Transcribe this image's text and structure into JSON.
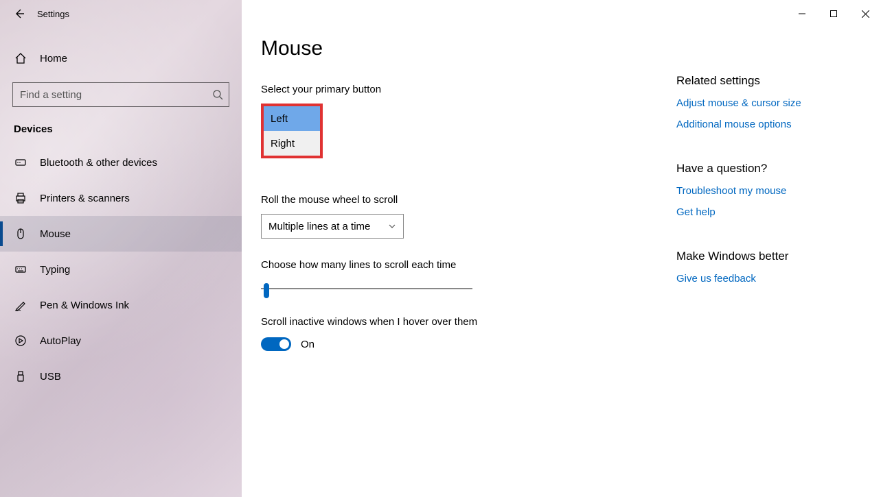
{
  "app_title": "Settings",
  "window_controls": {
    "minimize": "–",
    "maximize": "□",
    "close": "×"
  },
  "sidebar": {
    "home": "Home",
    "search_placeholder": "Find a setting",
    "category": "Devices",
    "items": [
      {
        "id": "bluetooth",
        "label": "Bluetooth & other devices"
      },
      {
        "id": "printers",
        "label": "Printers & scanners"
      },
      {
        "id": "mouse",
        "label": "Mouse",
        "selected": true
      },
      {
        "id": "typing",
        "label": "Typing"
      },
      {
        "id": "pen",
        "label": "Pen & Windows Ink"
      },
      {
        "id": "autoplay",
        "label": "AutoPlay"
      },
      {
        "id": "usb",
        "label": "USB"
      }
    ]
  },
  "page": {
    "title": "Mouse",
    "primary_button": {
      "label": "Select your primary button",
      "options": [
        "Left",
        "Right"
      ],
      "selected": "Left"
    },
    "roll_wheel": {
      "label": "Roll the mouse wheel to scroll",
      "value": "Multiple lines at a time"
    },
    "lines": {
      "label": "Choose how many lines to scroll each time"
    },
    "inactive": {
      "label": "Scroll inactive windows when I hover over them",
      "state_text": "On"
    }
  },
  "rail": {
    "related": {
      "head": "Related settings",
      "links": [
        "Adjust mouse & cursor size",
        "Additional mouse options"
      ]
    },
    "question": {
      "head": "Have a question?",
      "links": [
        "Troubleshoot my mouse",
        "Get help"
      ]
    },
    "better": {
      "head": "Make Windows better",
      "links": [
        "Give us feedback"
      ]
    }
  }
}
